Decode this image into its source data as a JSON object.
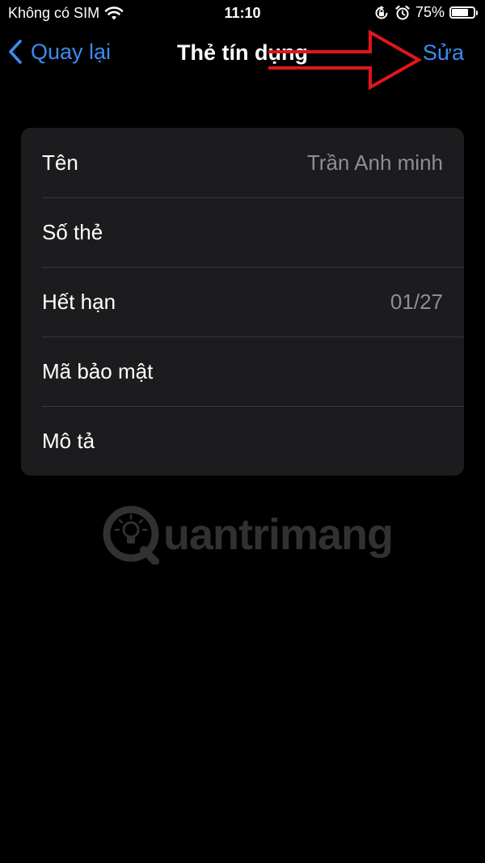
{
  "status_bar": {
    "carrier": "Không có SIM",
    "time": "11:10",
    "battery_text": "75%",
    "battery_level": 0.75,
    "icons": [
      "wifi-icon",
      "orientation-lock-icon",
      "alarm-icon",
      "battery-icon"
    ]
  },
  "nav": {
    "back_label": "Quay lại",
    "title": "Thẻ tín dụng",
    "edit_label": "Sửa"
  },
  "rows": [
    {
      "label": "Tên",
      "value": "Trần Anh minh"
    },
    {
      "label": "Số thẻ",
      "value": ""
    },
    {
      "label": "Hết hạn",
      "value": "01/27"
    },
    {
      "label": "Mã bảo mật",
      "value": ""
    },
    {
      "label": "Mô tả",
      "value": ""
    }
  ],
  "watermark": {
    "text": "uantrimang"
  },
  "colors": {
    "background": "#000000",
    "card": "#1c1c1e",
    "accent": "#3a8cf2",
    "secondary_text": "#8e8e93",
    "annotation_arrow": "#e0161b"
  }
}
